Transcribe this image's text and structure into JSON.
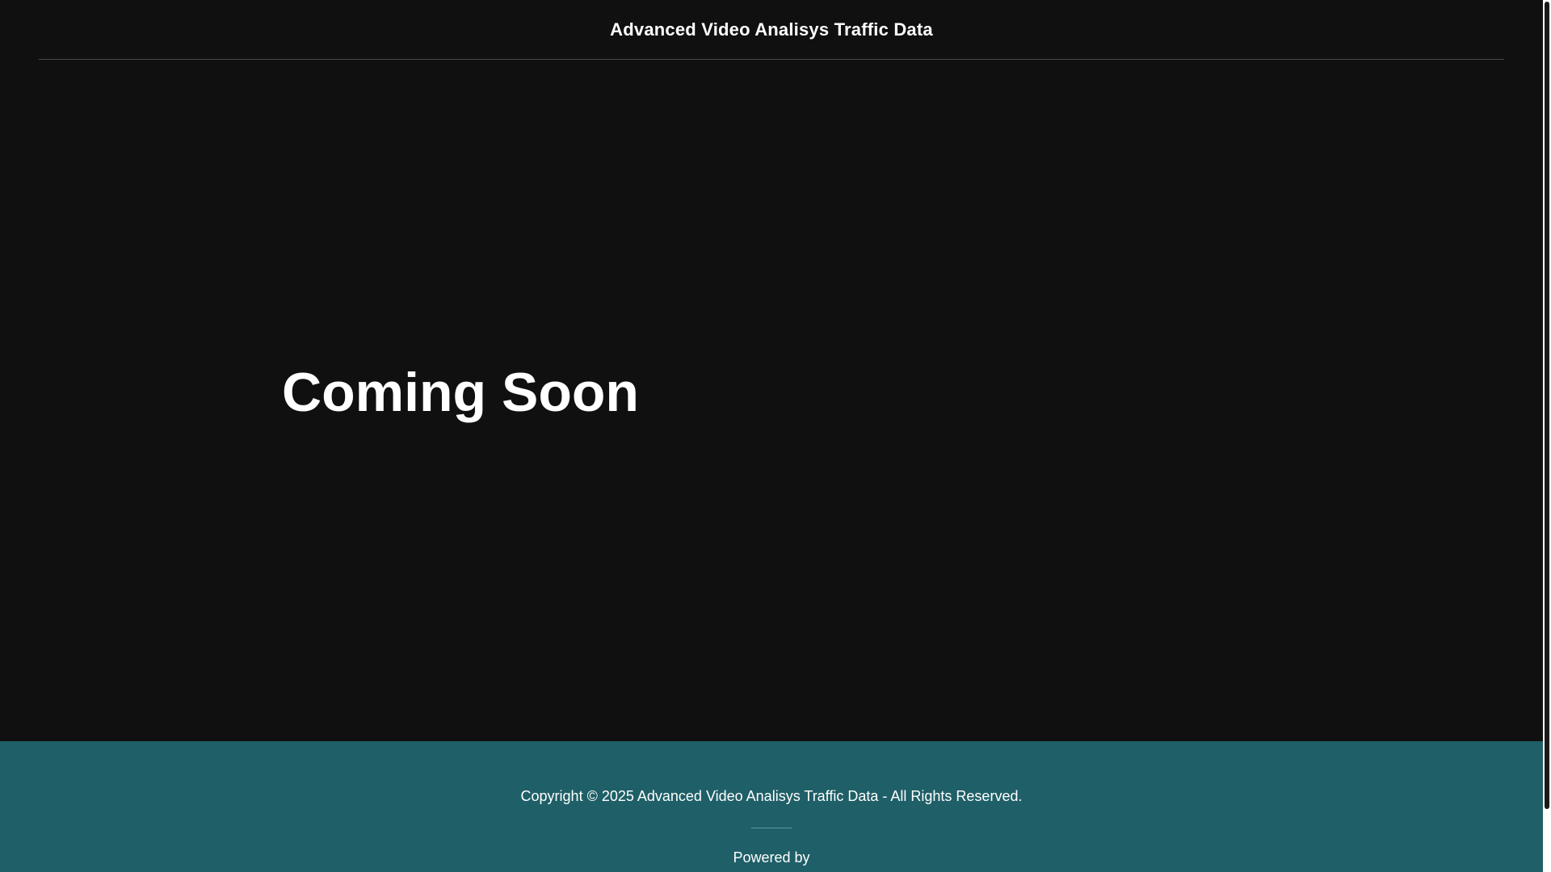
{
  "header": {
    "site_title": "Advanced Video Analisys Traffic Data"
  },
  "hero": {
    "title": "Coming Soon"
  },
  "footer": {
    "copyright": "Copyright © 2025 Advanced Video Analisys Traffic Data - All Rights Reserved.",
    "powered_by": "Powered by"
  },
  "colors": {
    "background": "#101010",
    "footer_background": "#1f5f67",
    "text": "#ffffff"
  }
}
